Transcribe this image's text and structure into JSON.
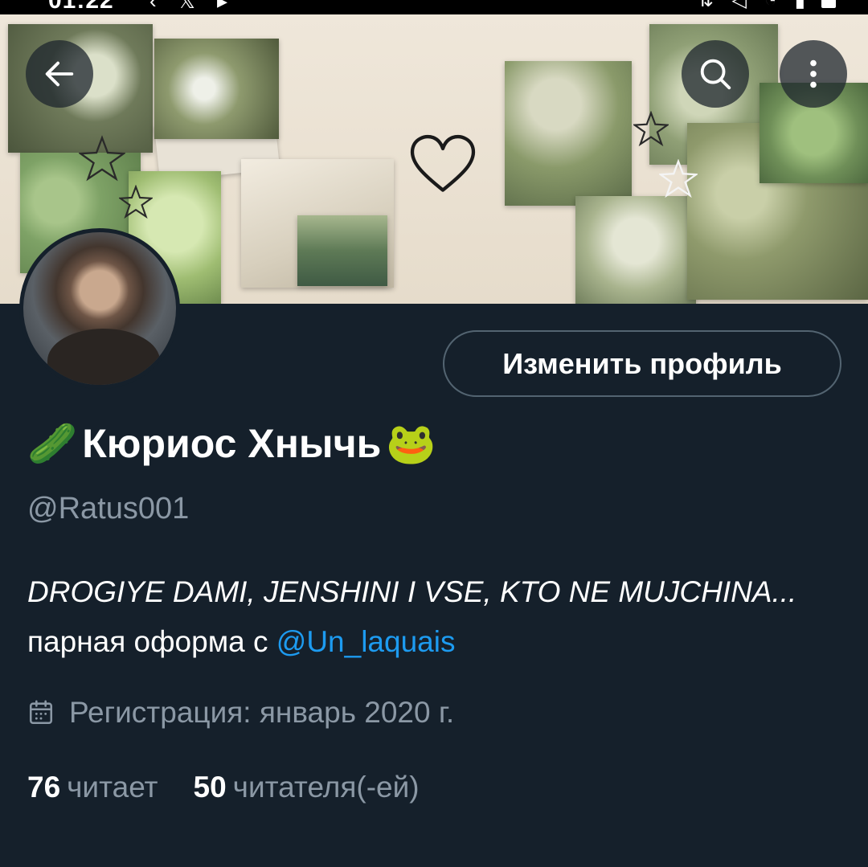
{
  "status_bar": {
    "time": "01:22",
    "left_icons": [
      "chevron-icon",
      "x-logo-icon",
      "play-icon"
    ],
    "right_icons": [
      "network-icon",
      "mute-icon",
      "wifi-icon",
      "signal-icon",
      "battery-icon"
    ]
  },
  "header": {
    "back_icon": "arrow-left-icon",
    "search_icon": "search-icon",
    "more_icon": "more-vertical-icon"
  },
  "profile": {
    "edit_button_label": "Изменить профиль",
    "display_name": "Кюриос Хнычь",
    "name_emoji_left": "🥒",
    "name_emoji_right": "🐸",
    "handle": "@Ratus001",
    "bio_italic": "DROGIYE DAMI, JENSHINI I VSE, KTO NE MUJCHINA...",
    "bio_text": "парная оформа с",
    "bio_mention": "@Un_laquais",
    "joined": "Регистрация: январь 2020 г.",
    "following_count": "76",
    "following_label": "читает",
    "followers_count": "50",
    "followers_label": "читателя(-ей)"
  },
  "colors": {
    "background": "#15202b",
    "text_primary": "#ffffff",
    "text_secondary": "#8b98a5",
    "accent": "#1d9bf0",
    "button_border": "#536471"
  }
}
